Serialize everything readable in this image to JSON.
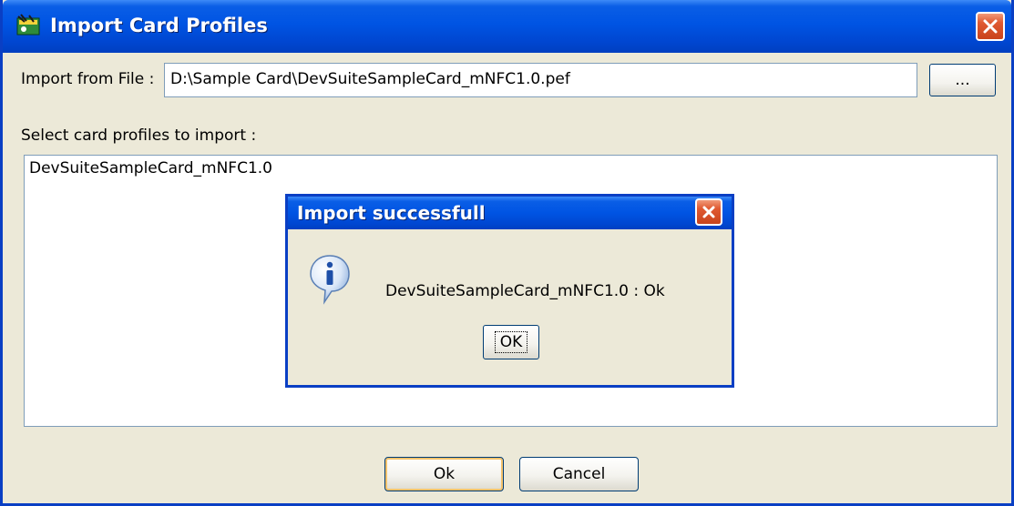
{
  "window": {
    "title": "Import Card Profiles",
    "icon": "card-profiles-app-icon"
  },
  "form": {
    "file_label": "Import from File :",
    "file_value": "D:\\Sample Card\\DevSuiteSampleCard_mNFC1.0.pef",
    "browse_label": "...",
    "select_label": "Select card profiles to import :",
    "profiles": [
      "DevSuiteSampleCard_mNFC1.0"
    ]
  },
  "buttons": {
    "ok_label": "Ok",
    "cancel_label": "Cancel"
  },
  "dialog": {
    "title": "Import successfull",
    "icon": "info-icon",
    "message": "DevSuiteSampleCard_mNFC1.0 : Ok",
    "ok_label": "OK"
  },
  "colors": {
    "titlebar": "#0054e3",
    "close_button": "#e05a32",
    "background": "#ece9d8"
  }
}
